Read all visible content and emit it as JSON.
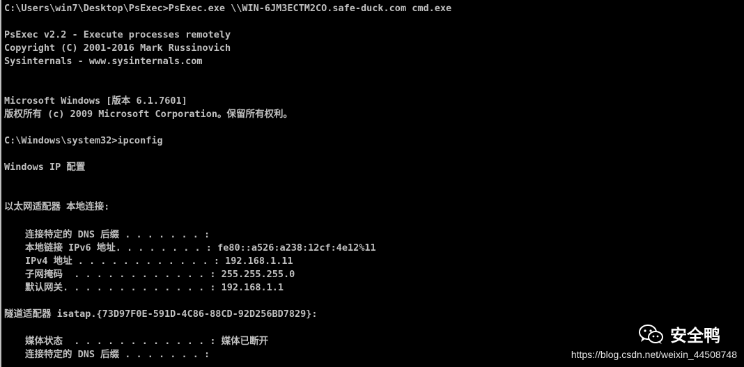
{
  "console": {
    "lines": [
      "C:\\Users\\win7\\Desktop\\PsExec>PsExec.exe \\\\WIN-6JM3ECTM2CO.safe-duck.com cmd.exe",
      "PsExec v2.2 - Execute processes remotely",
      "Copyright (C) 2001-2016 Mark Russinovich",
      "Sysinternals - www.sysinternals.com",
      "Microsoft Windows [版本 6.1.7601]",
      "版权所有 (c) 2009 Microsoft Corporation。保留所有权利。",
      "C:\\Windows\\system32>ipconfig",
      "Windows IP 配置",
      "以太网适配器 本地连接:",
      "连接特定的 DNS 后缀 . . . . . . . :",
      "本地链接 IPv6 地址. . . . . . . . : fe80::a526:a238:12cf:4e12%11",
      "IPv4 地址 . . . . . . . . . . . . : 192.168.1.11",
      "子网掩码  . . . . . . . . . . . . : 255.255.255.0",
      "默认网关. . . . . . . . . . . . . : 192.168.1.1",
      "隧道适配器 isatap.{73D97F0E-591D-4C86-88CD-92D256BD7829}:",
      "媒体状态  . . . . . . . . . . . . : 媒体已断开",
      "连接特定的 DNS 后缀 . . . . . . . :"
    ]
  },
  "watermark": {
    "name": "安全鸭",
    "url": "https://blog.csdn.net/weixin_44508748",
    "icon": "wechat-icon"
  },
  "colors": {
    "background": "#000000",
    "text": "#c0c0c0",
    "watermark": "#ffffff"
  }
}
